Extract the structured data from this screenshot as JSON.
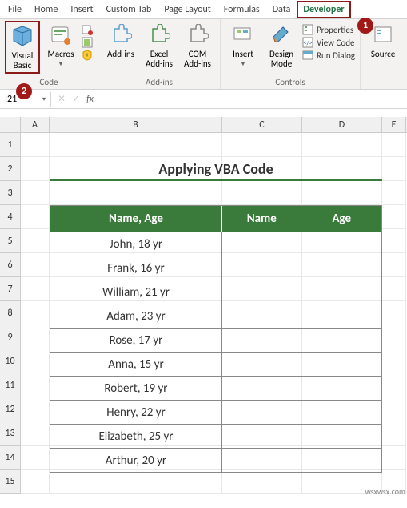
{
  "tabs": [
    "File",
    "Home",
    "Insert",
    "Custom Tab",
    "Page Layout",
    "Formulas",
    "Data",
    "Developer"
  ],
  "active_tab": "Developer",
  "ribbon": {
    "code": {
      "label": "Code",
      "visual_basic": "Visual Basic",
      "macros": "Macros"
    },
    "addins": {
      "label": "Add-ins",
      "addins": "Add-ins",
      "excel_addins": "Excel Add-ins",
      "com_addins": "COM Add-ins"
    },
    "controls": {
      "label": "Controls",
      "insert": "Insert",
      "design_mode": "Design Mode",
      "properties": "Properties",
      "view_code": "View Code",
      "run_dialog": "Run Dialog"
    },
    "xml": {
      "source": "Source"
    }
  },
  "badges": {
    "b1": "1",
    "b2": "2"
  },
  "namebox": "I21",
  "fx_label": "fx",
  "columns": [
    "A",
    "B",
    "C",
    "D",
    "E"
  ],
  "rows": [
    "1",
    "2",
    "3",
    "4",
    "5",
    "6",
    "7",
    "8",
    "9",
    "10",
    "11",
    "12",
    "13",
    "14",
    "15"
  ],
  "sheet_title": "Applying VBA Code",
  "table": {
    "headers": [
      "Name, Age",
      "Name",
      "Age"
    ],
    "data": [
      [
        "John, 18 yr",
        "",
        ""
      ],
      [
        "Frank, 16 yr",
        "",
        ""
      ],
      [
        "William, 21 yr",
        "",
        ""
      ],
      [
        "Adam, 23 yr",
        "",
        ""
      ],
      [
        "Rose, 17 yr",
        "",
        ""
      ],
      [
        "Anna, 15 yr",
        "",
        ""
      ],
      [
        "Robert, 19 yr",
        "",
        ""
      ],
      [
        "Henry, 22 yr",
        "",
        ""
      ],
      [
        "Elizabeth, 25 yr",
        "",
        ""
      ],
      [
        "Arthur, 20 yr",
        "",
        ""
      ]
    ]
  },
  "watermark": "wsxwsx.com"
}
